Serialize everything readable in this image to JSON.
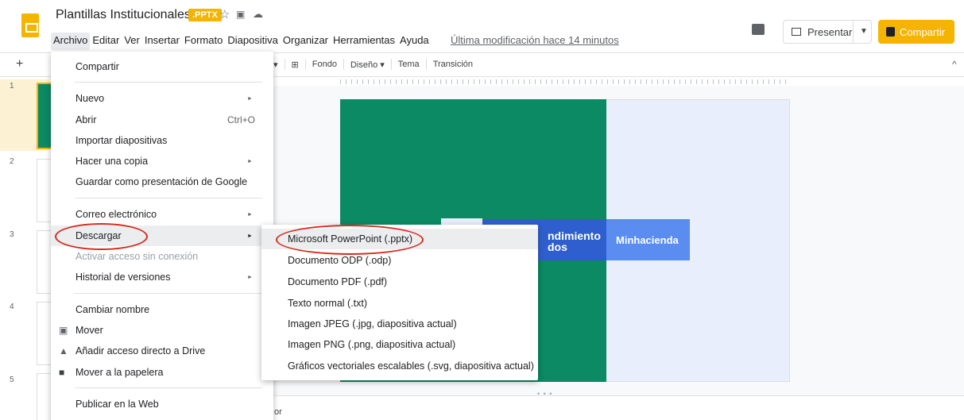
{
  "header": {
    "title": "Plantillas Institucionales _QR",
    "badge": ".PPTX",
    "last_modified": "Última modificación hace 14 minutos",
    "present_label": "Presentar",
    "share_label": "Compartir"
  },
  "menubar": [
    "Archivo",
    "Editar",
    "Ver",
    "Insertar",
    "Formato",
    "Diapositiva",
    "Organizar",
    "Herramientas",
    "Ayuda"
  ],
  "toolbar": {
    "plus": "+",
    "fondo": "Fondo",
    "diseno": "Diseño",
    "tema": "Tema",
    "transicion": "Transición"
  },
  "filmstrip": {
    "numbers": [
      "1",
      "2",
      "3",
      "4",
      "5"
    ]
  },
  "slide": {
    "blue_text_line1": "ndimiento",
    "blue_text_line2": "dos",
    "lightblue_text": "Minhacienda"
  },
  "notes_fragment": "or",
  "archivo_menu": {
    "compartir": "Compartir",
    "nuevo": "Nuevo",
    "abrir": "Abrir",
    "abrir_shortcut": "Ctrl+O",
    "importar": "Importar diapositivas",
    "copia": "Hacer una copia",
    "guardar_google": "Guardar como presentación de Google",
    "correo": "Correo electrónico",
    "descargar": "Descargar",
    "offline": "Activar acceso sin conexión",
    "historial": "Historial de versiones",
    "renombrar": "Cambiar nombre",
    "mover": "Mover",
    "atajo": "Añadir acceso directo a Drive",
    "papelera": "Mover a la papelera",
    "publicar": "Publicar en la Web"
  },
  "descargar_submenu": [
    "Microsoft PowerPoint (.pptx)",
    "Documento ODP (.odp)",
    "Documento PDF (.pdf)",
    "Texto normal (.txt)",
    "Imagen JPEG (.jpg, diapositiva actual)",
    "Imagen PNG (.png, diapositiva actual)",
    "Gráficos vectoriales escalables (.svg, diapositiva actual)"
  ],
  "colors": {
    "accent_yellow": "#f4b400",
    "slide_green": "#0b8a63",
    "slide_blue": "#2f5fce",
    "annotation_red": "#d52b1e"
  }
}
